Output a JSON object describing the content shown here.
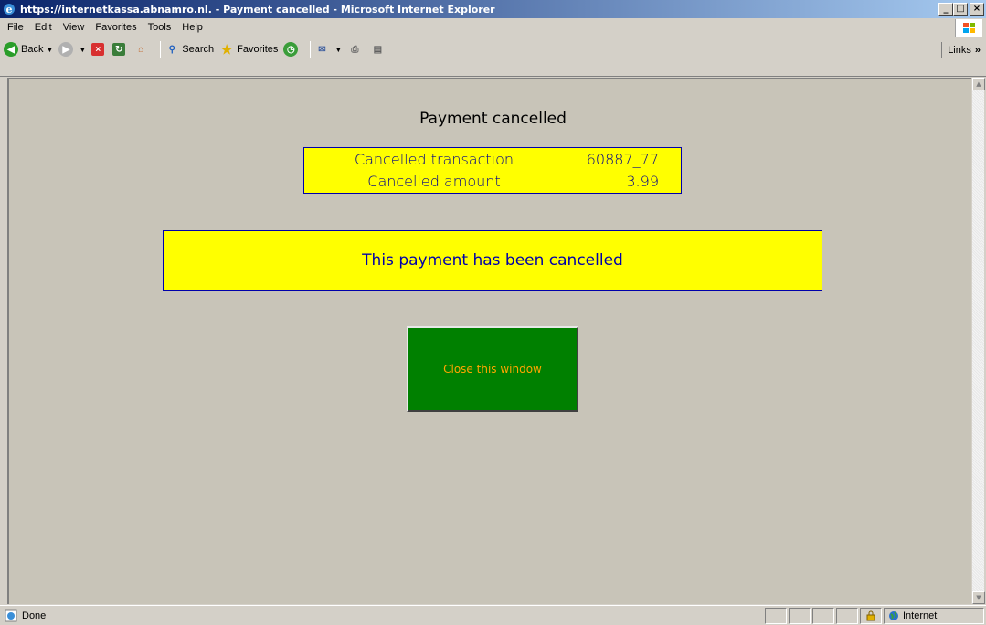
{
  "window": {
    "title": "https://internetkassa.abnamro.nl. - Payment cancelled - Microsoft Internet Explorer"
  },
  "menu": [
    "File",
    "Edit",
    "View",
    "Favorites",
    "Tools",
    "Help"
  ],
  "toolbar": {
    "back": "Back",
    "search": "Search",
    "favorites": "Favorites",
    "links": "Links"
  },
  "page": {
    "heading": "Payment cancelled",
    "info": {
      "transaction_label": "Cancelled transaction",
      "transaction_value": "60887_77",
      "amount_label": "Cancelled amount",
      "amount_value": "3.99"
    },
    "message": "This payment has been cancelled",
    "close_button": "Close this window"
  },
  "status": {
    "text": "Done",
    "zone": "Internet"
  },
  "colors": {
    "box_bg": "#ffff00",
    "box_text": "#0000aa",
    "button_bg": "#008000",
    "button_text": "#ffa500",
    "page_bg": "#c8c4b8"
  }
}
